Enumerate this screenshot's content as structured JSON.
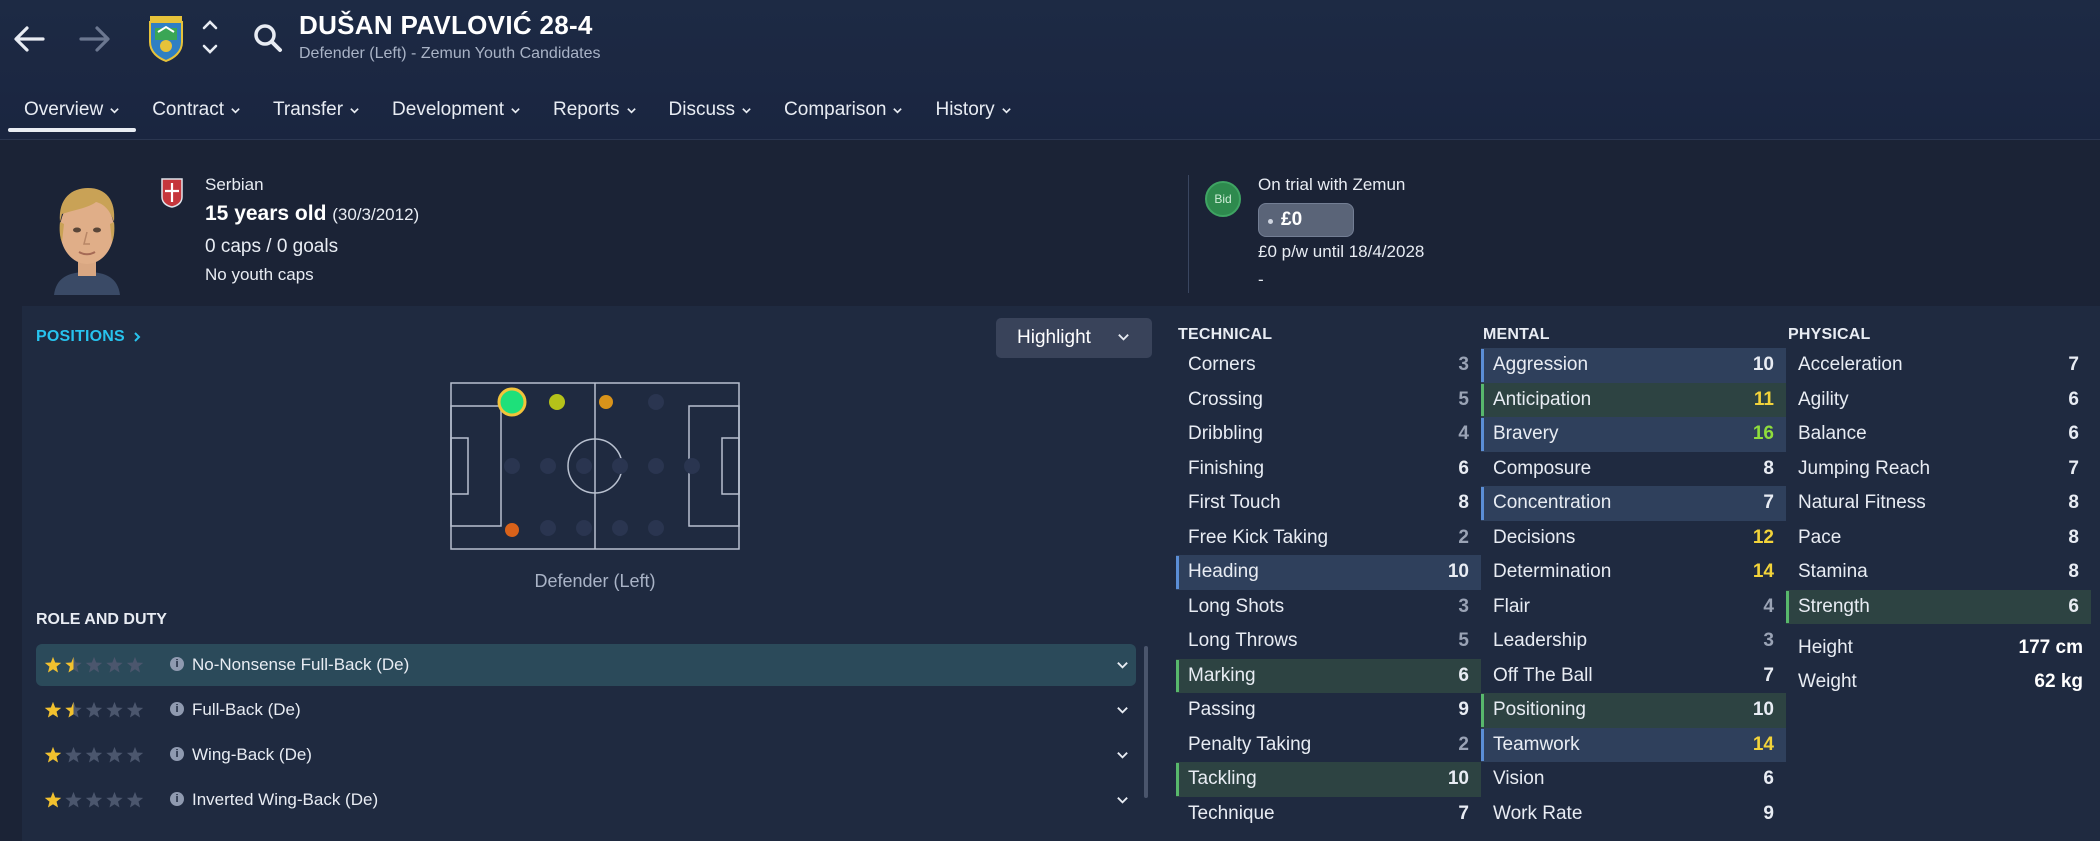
{
  "header": {
    "player_name": "DUŠAN PAVLOVIĆ 28-4",
    "player_subtitle": "Defender (Left) - Zemun Youth Candidates"
  },
  "tabs": [
    {
      "label": "Overview"
    },
    {
      "label": "Contract"
    },
    {
      "label": "Transfer"
    },
    {
      "label": "Development"
    },
    {
      "label": "Reports"
    },
    {
      "label": "Discuss"
    },
    {
      "label": "Comparison"
    },
    {
      "label": "History"
    }
  ],
  "bio": {
    "nationality": "Serbian",
    "age": "15 years old",
    "dob": "(30/3/2012)",
    "caps": "0 caps / 0 goals",
    "youth_caps": "No youth caps",
    "bid_label": "Bid",
    "trial_text": "On trial with Zemun",
    "fee": "£0",
    "wage": "£0 p/w until 18/4/2028",
    "extra": "-"
  },
  "positions": {
    "link_label": "POSITIONS",
    "highlight_label": "Highlight",
    "position_label": "Defender (Left)"
  },
  "role_duty": {
    "title": "ROLE AND DUTY",
    "roles": [
      {
        "name": "No-Nonsense Full-Back (De)",
        "stars": 1.5,
        "selected": true
      },
      {
        "name": "Full-Back (De)",
        "stars": 1.5,
        "selected": false
      },
      {
        "name": "Wing-Back (De)",
        "stars": 1,
        "selected": false
      },
      {
        "name": "Inverted Wing-Back (De)",
        "stars": 1,
        "selected": false
      }
    ]
  },
  "attributes": {
    "technical": {
      "title": "TECHNICAL",
      "rows": [
        {
          "name": "Corners",
          "value": "3",
          "hl": ""
        },
        {
          "name": "Crossing",
          "value": "5",
          "hl": ""
        },
        {
          "name": "Dribbling",
          "value": "4",
          "hl": ""
        },
        {
          "name": "Finishing",
          "value": "6",
          "hl": ""
        },
        {
          "name": "First Touch",
          "value": "8",
          "hl": ""
        },
        {
          "name": "Free Kick Taking",
          "value": "2",
          "hl": ""
        },
        {
          "name": "Heading",
          "value": "10",
          "hl": "blue"
        },
        {
          "name": "Long Shots",
          "value": "3",
          "hl": ""
        },
        {
          "name": "Long Throws",
          "value": "5",
          "hl": ""
        },
        {
          "name": "Marking",
          "value": "6",
          "hl": "green"
        },
        {
          "name": "Passing",
          "value": "9",
          "hl": ""
        },
        {
          "name": "Penalty Taking",
          "value": "2",
          "hl": ""
        },
        {
          "name": "Tackling",
          "value": "10",
          "hl": "green"
        },
        {
          "name": "Technique",
          "value": "7",
          "hl": ""
        }
      ]
    },
    "mental": {
      "title": "MENTAL",
      "rows": [
        {
          "name": "Aggression",
          "value": "10",
          "hl": "blue"
        },
        {
          "name": "Anticipation",
          "value": "11",
          "hl": "green"
        },
        {
          "name": "Bravery",
          "value": "16",
          "hl": "blue"
        },
        {
          "name": "Composure",
          "value": "8",
          "hl": ""
        },
        {
          "name": "Concentration",
          "value": "7",
          "hl": "blue"
        },
        {
          "name": "Decisions",
          "value": "12",
          "hl": ""
        },
        {
          "name": "Determination",
          "value": "14",
          "hl": ""
        },
        {
          "name": "Flair",
          "value": "4",
          "hl": ""
        },
        {
          "name": "Leadership",
          "value": "3",
          "hl": ""
        },
        {
          "name": "Off The Ball",
          "value": "7",
          "hl": ""
        },
        {
          "name": "Positioning",
          "value": "10",
          "hl": "green"
        },
        {
          "name": "Teamwork",
          "value": "14",
          "hl": "blue"
        },
        {
          "name": "Vision",
          "value": "6",
          "hl": ""
        },
        {
          "name": "Work Rate",
          "value": "9",
          "hl": ""
        }
      ]
    },
    "physical": {
      "title": "PHYSICAL",
      "rows": [
        {
          "name": "Acceleration",
          "value": "7",
          "hl": ""
        },
        {
          "name": "Agility",
          "value": "6",
          "hl": ""
        },
        {
          "name": "Balance",
          "value": "6",
          "hl": ""
        },
        {
          "name": "Jumping Reach",
          "value": "7",
          "hl": ""
        },
        {
          "name": "Natural Fitness",
          "value": "8",
          "hl": ""
        },
        {
          "name": "Pace",
          "value": "8",
          "hl": ""
        },
        {
          "name": "Stamina",
          "value": "8",
          "hl": ""
        },
        {
          "name": "Strength",
          "value": "6",
          "hl": "green"
        }
      ],
      "height_label": "Height",
      "height_value": "177 cm",
      "weight_label": "Weight",
      "weight_value": "62 kg"
    }
  },
  "colors": {
    "accent": "#27c3ee",
    "value_good": "#f2d33a",
    "value_very_good": "#8fdd3c"
  }
}
